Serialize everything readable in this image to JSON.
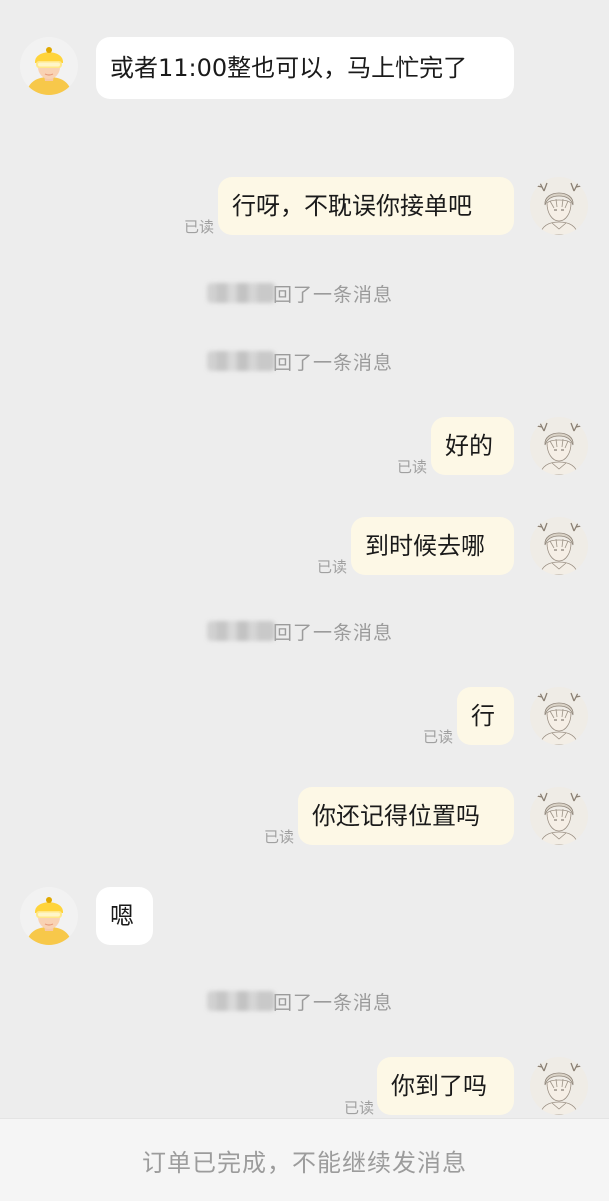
{
  "messages": {
    "m1": "或者11:00整也可以，马上忙完了",
    "m2": "行呀，不耽误你接单吧",
    "m3": "好的",
    "m4": "到时候去哪",
    "m5": "行",
    "m6": "你还记得位置吗",
    "m7": "嗯",
    "m8": "你到了吗"
  },
  "read_label": "已读",
  "system_reply": "回了一条消息",
  "footer": {
    "text": "订单已完成，不能继续发消息"
  },
  "icons": {
    "other_avatar": "yellow-helmet-rider-avatar",
    "self_avatar": "anime-boy-with-antlers-avatar"
  },
  "colors": {
    "background": "#ededed",
    "incoming_bubble": "#ffffff",
    "outgoing_bubble": "#fdf8e6"
  }
}
